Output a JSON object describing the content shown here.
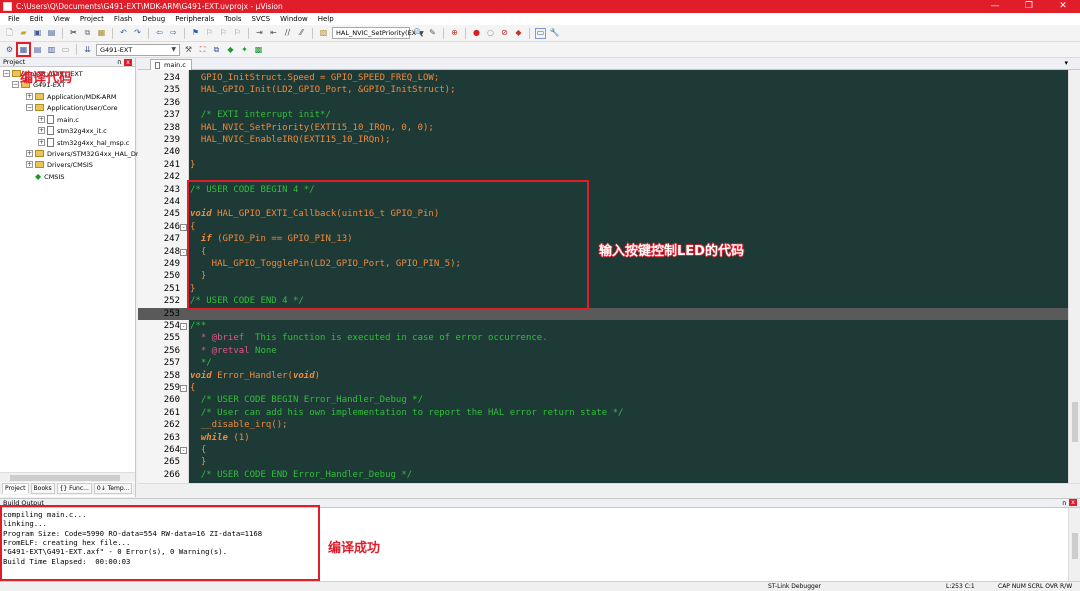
{
  "window": {
    "title": "C:\\Users\\Q\\Documents\\G491-EXT\\MDK-ARM\\G491-EXT.uvprojx - µVision",
    "minimize": "—",
    "maximize": "❐",
    "close": "✕"
  },
  "menu": [
    "File",
    "Edit",
    "View",
    "Project",
    "Flash",
    "Debug",
    "Peripherals",
    "Tools",
    "SVCS",
    "Window",
    "Help"
  ],
  "toolbar": {
    "function_combo": "HAL_NVIC_SetPriority(EX",
    "target_combo": "G491-EXT"
  },
  "project_panel": {
    "title": "Project",
    "pin": "ᴨ",
    "close": "x",
    "tree": [
      {
        "label": "Project: G491-EXT",
        "type": "root"
      },
      {
        "label": "G491-EXT",
        "type": "target"
      },
      {
        "label": "Application/MDK-ARM",
        "type": "folder"
      },
      {
        "label": "Application/User/Core",
        "type": "folder"
      },
      {
        "label": "main.c",
        "type": "file"
      },
      {
        "label": "stm32g4xx_it.c",
        "type": "file"
      },
      {
        "label": "stm32g4xx_hal_msp.c",
        "type": "file"
      },
      {
        "label": "Drivers/STM32G4xx_HAL_Dri",
        "type": "folder"
      },
      {
        "label": "Drivers/CMSIS",
        "type": "folder"
      },
      {
        "label": "CMSIS",
        "type": "component"
      }
    ],
    "tabs": [
      "Project",
      "Books",
      "{} Func...",
      "0↓ Temp..."
    ]
  },
  "annotations": {
    "compile_code": "编译代码",
    "led_code": "输入按键控制LED的代码",
    "compile_success": "编译成功"
  },
  "editor": {
    "tab": "main.c",
    "lines": [
      {
        "n": "234",
        "code": "  GPIO_InitStruct.Speed = GPIO_SPEED_FREQ_LOW;",
        "type": "code",
        "fold": ""
      },
      {
        "n": "235",
        "code": "  HAL_GPIO_Init(LD2_GPIO_Port, &GPIO_InitStruct);",
        "type": "code",
        "fold": ""
      },
      {
        "n": "236",
        "code": "",
        "type": "code",
        "fold": ""
      },
      {
        "n": "237",
        "code": "  /* EXTI interrupt init*/",
        "type": "comment",
        "fold": ""
      },
      {
        "n": "238",
        "code": "  HAL_NVIC_SetPriority(EXTI15_10_IRQn, 0, 0);",
        "type": "code",
        "fold": ""
      },
      {
        "n": "239",
        "code": "  HAL_NVIC_EnableIRQ(EXTI15_10_IRQn);",
        "type": "code",
        "fold": ""
      },
      {
        "n": "240",
        "code": "",
        "type": "code",
        "fold": ""
      },
      {
        "n": "241",
        "code": "}",
        "type": "code",
        "fold": ""
      },
      {
        "n": "242",
        "code": "",
        "type": "code",
        "fold": ""
      },
      {
        "n": "243",
        "code": "/* USER CODE BEGIN 4 */",
        "type": "comment",
        "fold": ""
      },
      {
        "n": "244",
        "code": "",
        "type": "code",
        "fold": ""
      },
      {
        "n": "245",
        "code": "HAL_GPIO_EXTI_Callback(uint16_t GPIO_Pin)",
        "kw": "void ",
        "type": "code",
        "fold": ""
      },
      {
        "n": "246",
        "code": "{",
        "type": "code",
        "fold": "-"
      },
      {
        "n": "247",
        "code": " (GPIO_Pin == GPIO_PIN_13)",
        "kw": "  if",
        "type": "code",
        "fold": ""
      },
      {
        "n": "248",
        "code": "  {",
        "type": "code",
        "fold": "-"
      },
      {
        "n": "249",
        "code": "    HAL_GPIO_TogglePin(LD2_GPIO_Port, GPIO_PIN_5);",
        "type": "code",
        "fold": ""
      },
      {
        "n": "250",
        "code": "  }",
        "type": "code",
        "fold": ""
      },
      {
        "n": "251",
        "code": "}",
        "type": "code",
        "fold": ""
      },
      {
        "n": "252",
        "code": "/* USER CODE END 4 */",
        "type": "comment",
        "fold": ""
      },
      {
        "n": "253",
        "code": "",
        "type": "current",
        "fold": ""
      },
      {
        "n": "254",
        "code": "/**",
        "type": "comment",
        "fold": "-"
      },
      {
        "n": "255",
        "code": " This function is executed in case of error occurrence.",
        "tag": "  * @brief ",
        "type": "doccomment",
        "fold": ""
      },
      {
        "n": "256",
        "code": " None",
        "tag": "  * @retval",
        "type": "doccomment",
        "fold": ""
      },
      {
        "n": "257",
        "code": "  */",
        "type": "comment",
        "fold": ""
      },
      {
        "n": "258",
        "code": " Error_Handler(",
        "kw": "void",
        "kw2": "void",
        "tail": ")",
        "type": "code",
        "fold": ""
      },
      {
        "n": "259",
        "code": "{",
        "type": "code",
        "fold": "-"
      },
      {
        "n": "260",
        "code": "  /* USER CODE BEGIN Error_Handler_Debug */",
        "type": "comment",
        "fold": ""
      },
      {
        "n": "261",
        "code": "  /* User can add his own implementation to report the HAL error return state */",
        "type": "comment",
        "fold": ""
      },
      {
        "n": "262",
        "code": "  __disable_irq();",
        "type": "code",
        "fold": ""
      },
      {
        "n": "263",
        "code": " (1)",
        "kw": "  while",
        "type": "code",
        "fold": ""
      },
      {
        "n": "264",
        "code": "  {",
        "type": "code",
        "fold": "-"
      },
      {
        "n": "265",
        "code": "  }",
        "type": "code",
        "fold": ""
      },
      {
        "n": "266",
        "code": "  /* USER CODE END Error_Handler_Debug */",
        "type": "comment",
        "fold": ""
      }
    ]
  },
  "build_output": {
    "title": "Build Output",
    "pin": "ᴨ",
    "close": "x",
    "lines": [
      "compiling main.c...",
      "linking...",
      "Program Size: Code=5990 RO-data=554 RW-data=16 ZI-data=1168",
      "FromELF: creating hex file...",
      "\"G491-EXT\\G491-EXT.axf\" - 0 Error(s), 0 Warning(s).",
      "Build Time Elapsed:  00:00:03"
    ]
  },
  "status": {
    "debugger": "ST-Link Debugger",
    "position": "L:253 C:1",
    "indicators": "CAP  NUM  SCRL  OVR  R/W"
  }
}
